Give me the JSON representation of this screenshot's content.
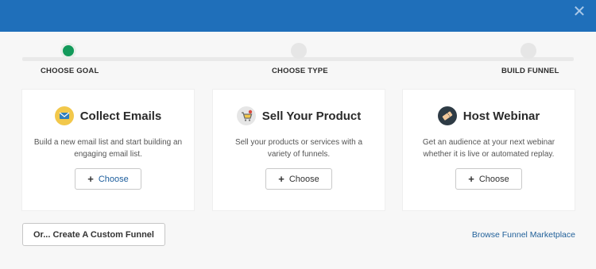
{
  "window": {
    "close_icon": "close-icon",
    "accent_color": "#1f6fba"
  },
  "steps": [
    {
      "label": "CHOOSE GOAL",
      "active": true
    },
    {
      "label": "CHOOSE TYPE",
      "active": false
    },
    {
      "label": "BUILD FUNNEL",
      "active": false
    }
  ],
  "cards": [
    {
      "title": "Collect Emails",
      "description": "Build a new email list and start building an engaging email list.",
      "icon": "envelope-icon",
      "button": "Choose"
    },
    {
      "title": "Sell Your Product",
      "description": "Sell your products or services with a variety of funnels.",
      "icon": "shopping-cart-icon",
      "button": "Choose"
    },
    {
      "title": "Host Webinar",
      "description": "Get an audience at your next webinar whether it is live or automated replay.",
      "icon": "ticket-icon",
      "button": "Choose"
    }
  ],
  "footer": {
    "custom_funnel_button": "Or... Create A Custom Funnel",
    "marketplace_link": "Browse Funnel Marketplace"
  }
}
